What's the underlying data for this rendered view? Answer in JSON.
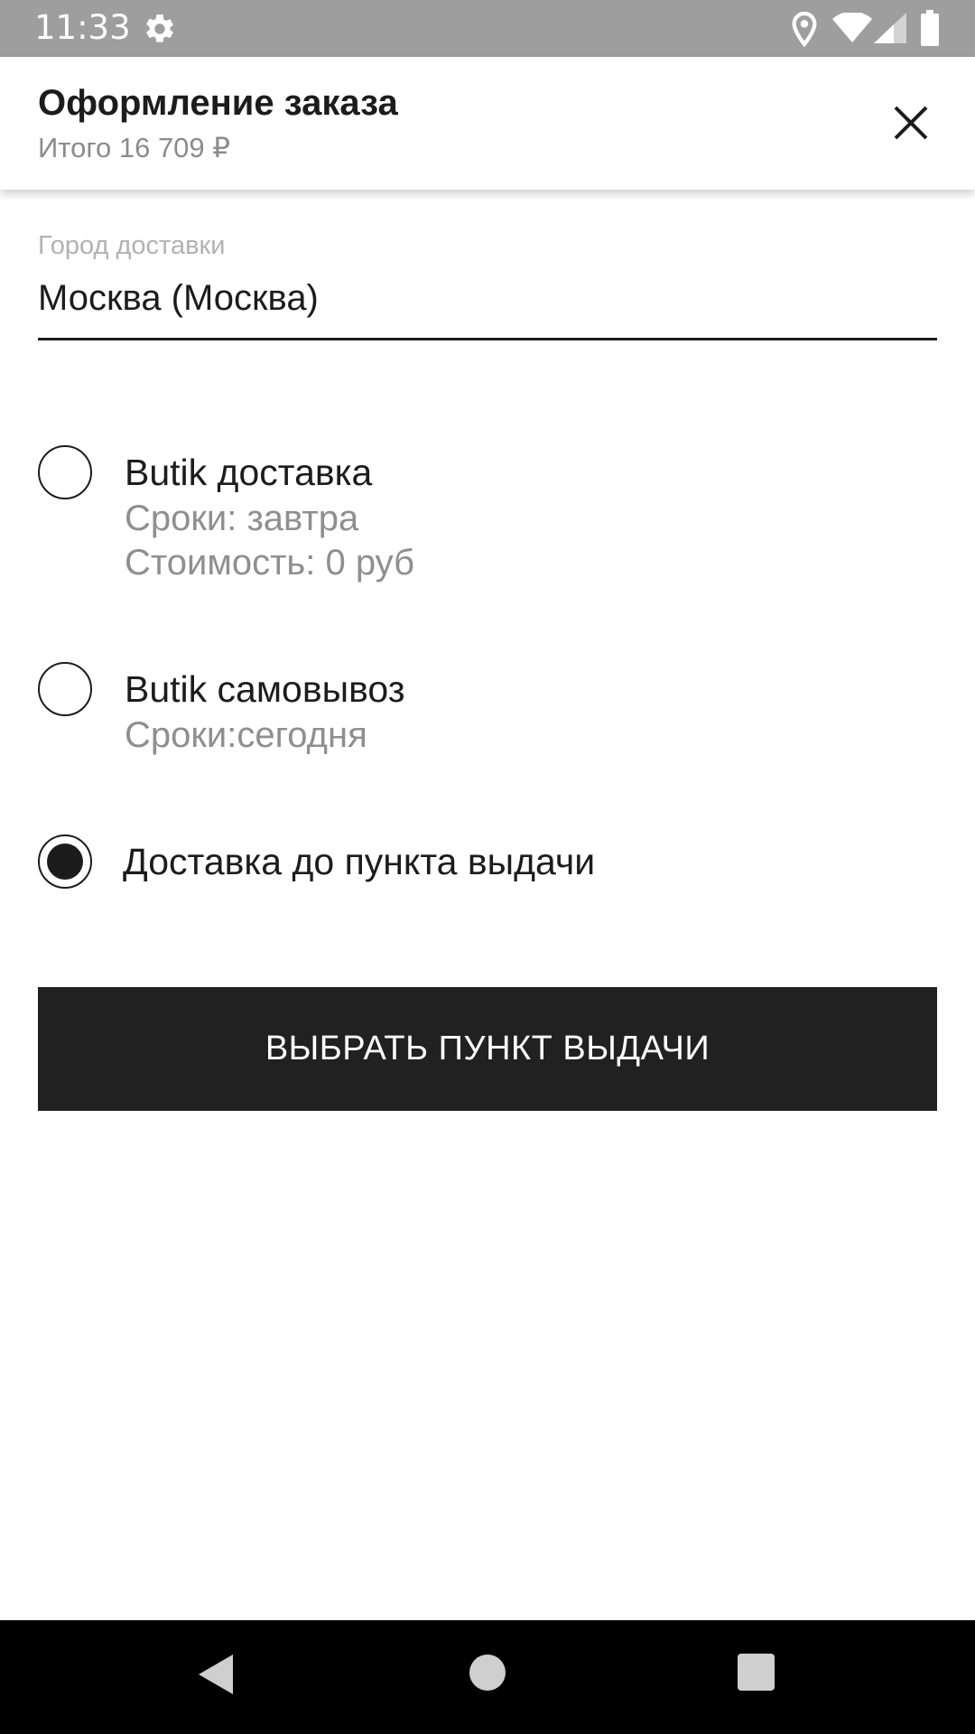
{
  "status_bar": {
    "time": "11:33",
    "icons": [
      "gear-icon",
      "location-icon",
      "wifi-icon",
      "signal-icon",
      "battery-icon"
    ]
  },
  "header": {
    "title": "Оформление заказа",
    "subtitle": "Итого 16 709 ₽",
    "close_icon": "close-icon"
  },
  "city": {
    "label": "Город доставки",
    "value": "Москва (Москва)"
  },
  "delivery_options": [
    {
      "title": "Butik доставка",
      "lines": [
        "Сроки: завтра",
        "Стоимость: 0 руб"
      ],
      "selected": false
    },
    {
      "title": "Butik самовывоз",
      "lines": [
        "Сроки:сегодня"
      ],
      "selected": false
    },
    {
      "title": "Доставка до пункта выдачи",
      "lines": [],
      "selected": true
    }
  ],
  "button": {
    "label": "ВЫБРАТЬ ПУНКТ ВЫДАЧИ"
  },
  "nav_bar": {
    "icons": [
      "back-icon",
      "home-icon",
      "recents-icon"
    ]
  },
  "colors": {
    "status_bar": "#9e9e9e",
    "text_primary": "#1c1c1c",
    "text_secondary": "#8f8f8f",
    "button_bg": "#212121",
    "nav_bar": "#000000"
  }
}
